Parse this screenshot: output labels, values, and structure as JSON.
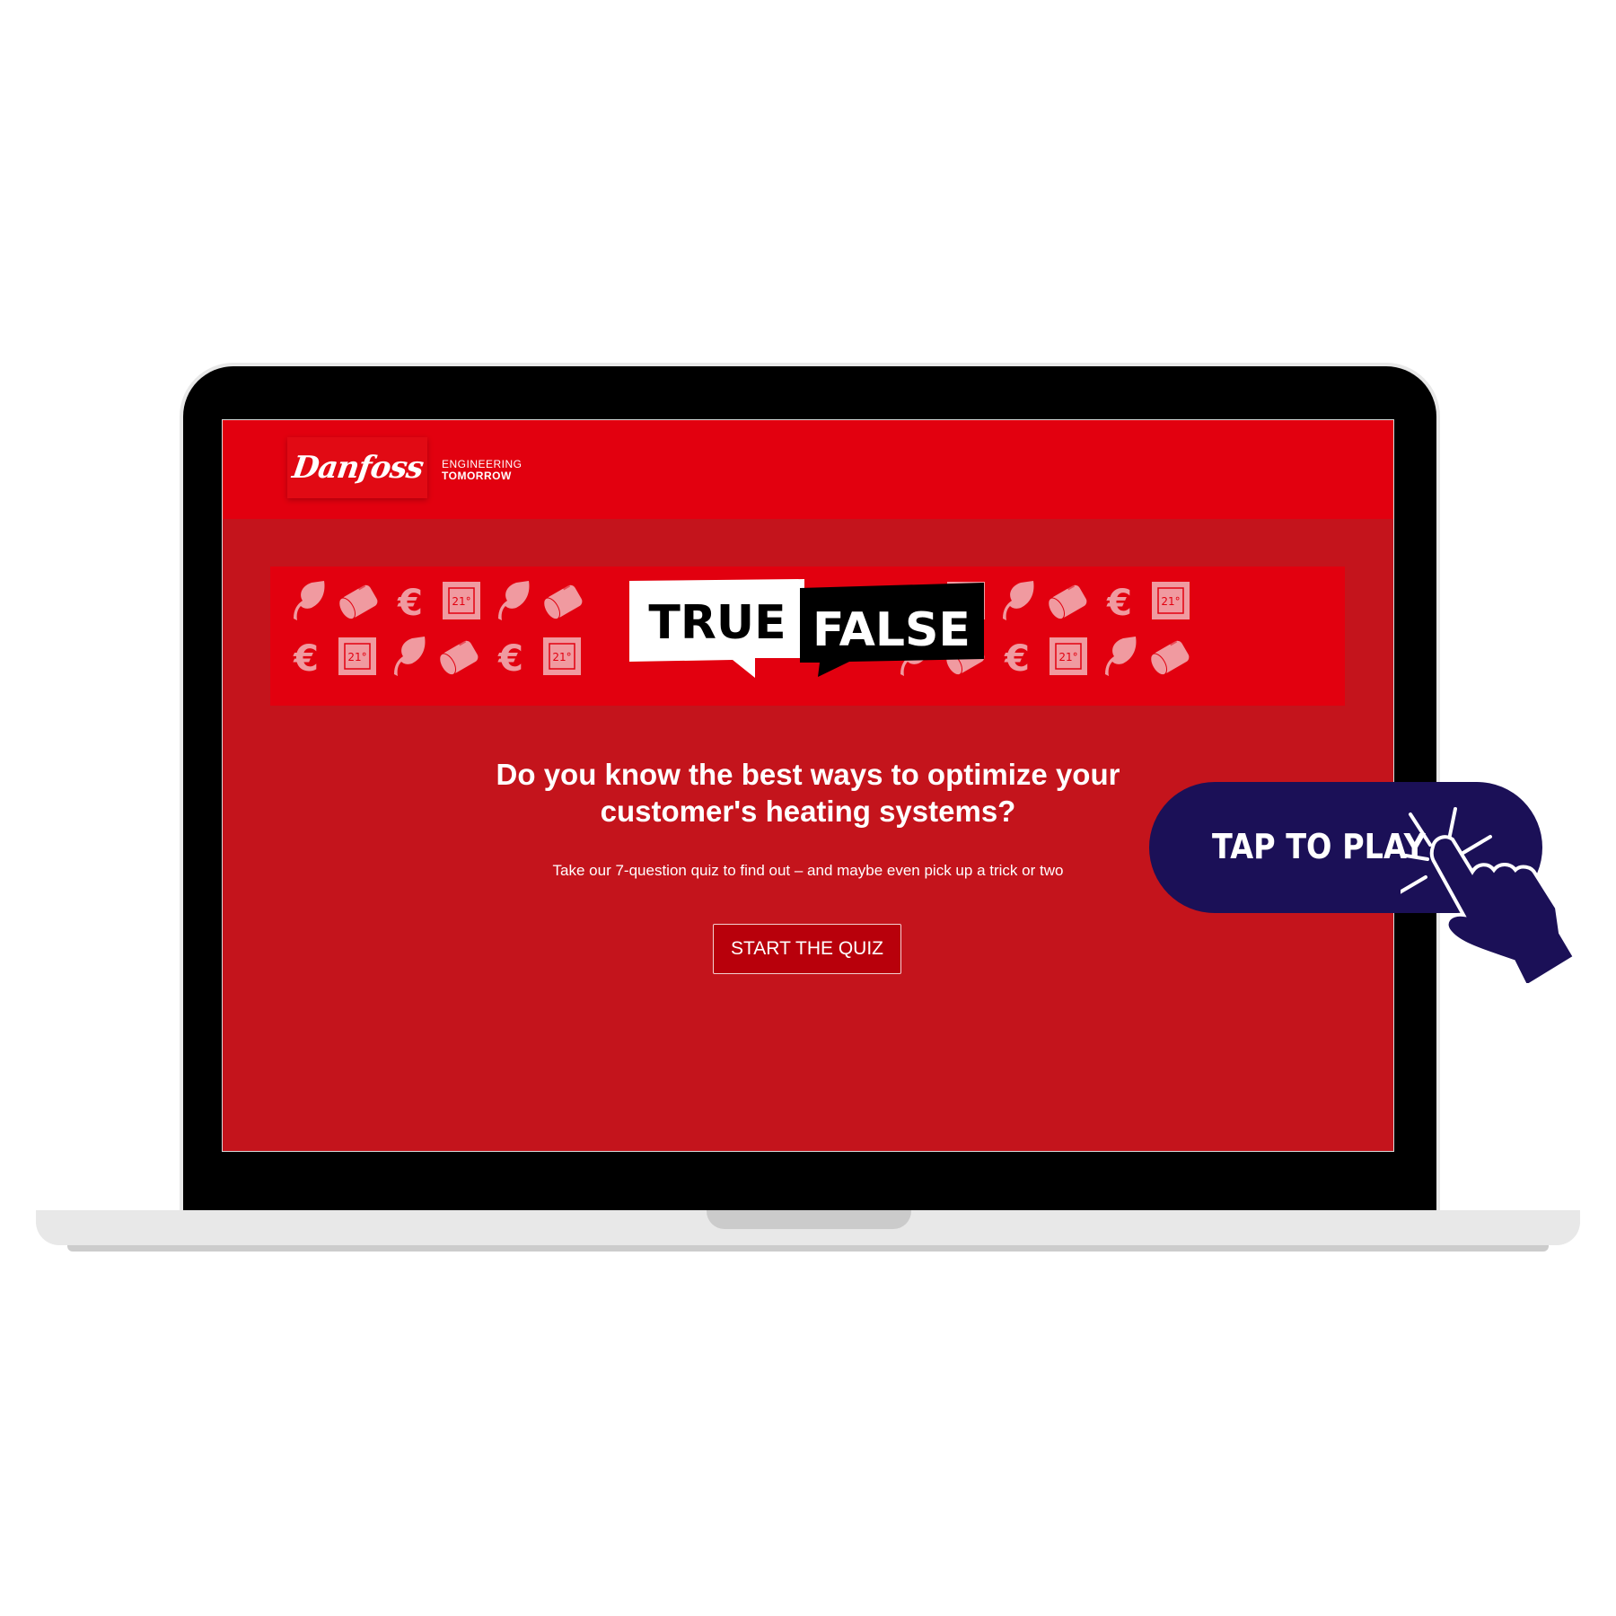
{
  "header": {
    "brand": "Danfoss",
    "tagline_line1": "ENGINEERING",
    "tagline_line2": "TOMORROW"
  },
  "banner": {
    "true_label": "TRUE",
    "false_label": "FALSE",
    "thermostat_reading": "21°",
    "row1_left": [
      "leaf",
      "thermostat-head",
      "euro",
      "thermostat",
      "leaf",
      "thermostat-head"
    ],
    "row1_right": [
      "euro",
      "thermostat",
      "leaf",
      "thermostat-head",
      "euro",
      "thermostat"
    ],
    "row2_left": [
      "euro",
      "thermostat",
      "leaf",
      "thermostat-head",
      "euro",
      "thermostat"
    ],
    "row2_right": [
      "leaf",
      "thermostat-head",
      "euro",
      "thermostat",
      "leaf",
      "thermostat-head"
    ]
  },
  "main": {
    "headline_line1": "Do you know the best ways to optimize your",
    "headline_line2": "customer's heating systems?",
    "subtitle": "Take our 7-question quiz to find out – and maybe even pick up a trick or two",
    "start_button": "START THE QUIZ"
  },
  "overlay": {
    "tap_label": "TAP TO PLAY",
    "icon": "hand-tap-icon"
  },
  "colors": {
    "header_red": "#e2000f",
    "body_red": "#c4141c",
    "button_red": "#b8000b",
    "navy": "#1b1057",
    "icon_tint": "#f09aa0"
  }
}
